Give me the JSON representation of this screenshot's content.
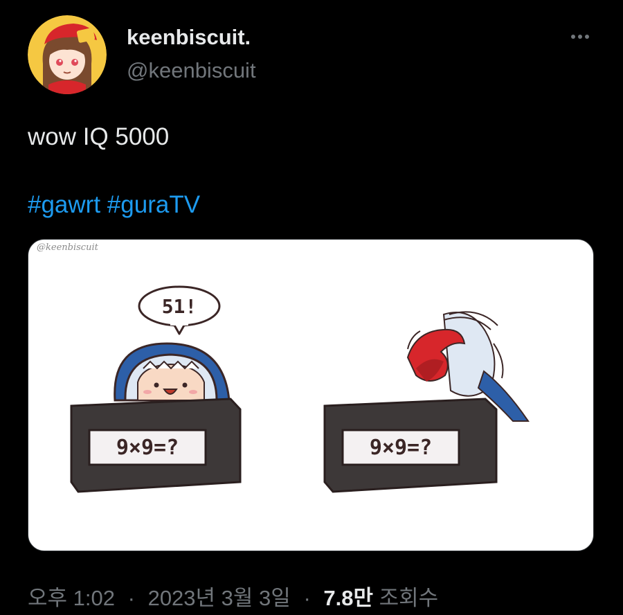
{
  "author": {
    "display_name": "keenbiscuit.",
    "handle": "@keenbiscuit"
  },
  "tweet": {
    "text": "wow IQ 5000",
    "hashtags": [
      "#gawrt",
      "#guraTV"
    ]
  },
  "media": {
    "watermark": "@keenbiscuit",
    "speech_bubble": "51!",
    "math_sign_left": "9×9=?",
    "math_sign_right": "9×9=?"
  },
  "meta": {
    "time": "오후 1:02",
    "date": "2023년 3월 3일",
    "views_count": "7.8만",
    "views_label": "조회수",
    "separator": "·"
  },
  "icons": {
    "more": "more-horizontal-icon"
  },
  "colors": {
    "background": "#000000",
    "text_primary": "#e7e9ea",
    "text_secondary": "#71767b",
    "hashtag": "#1d9bf0"
  }
}
